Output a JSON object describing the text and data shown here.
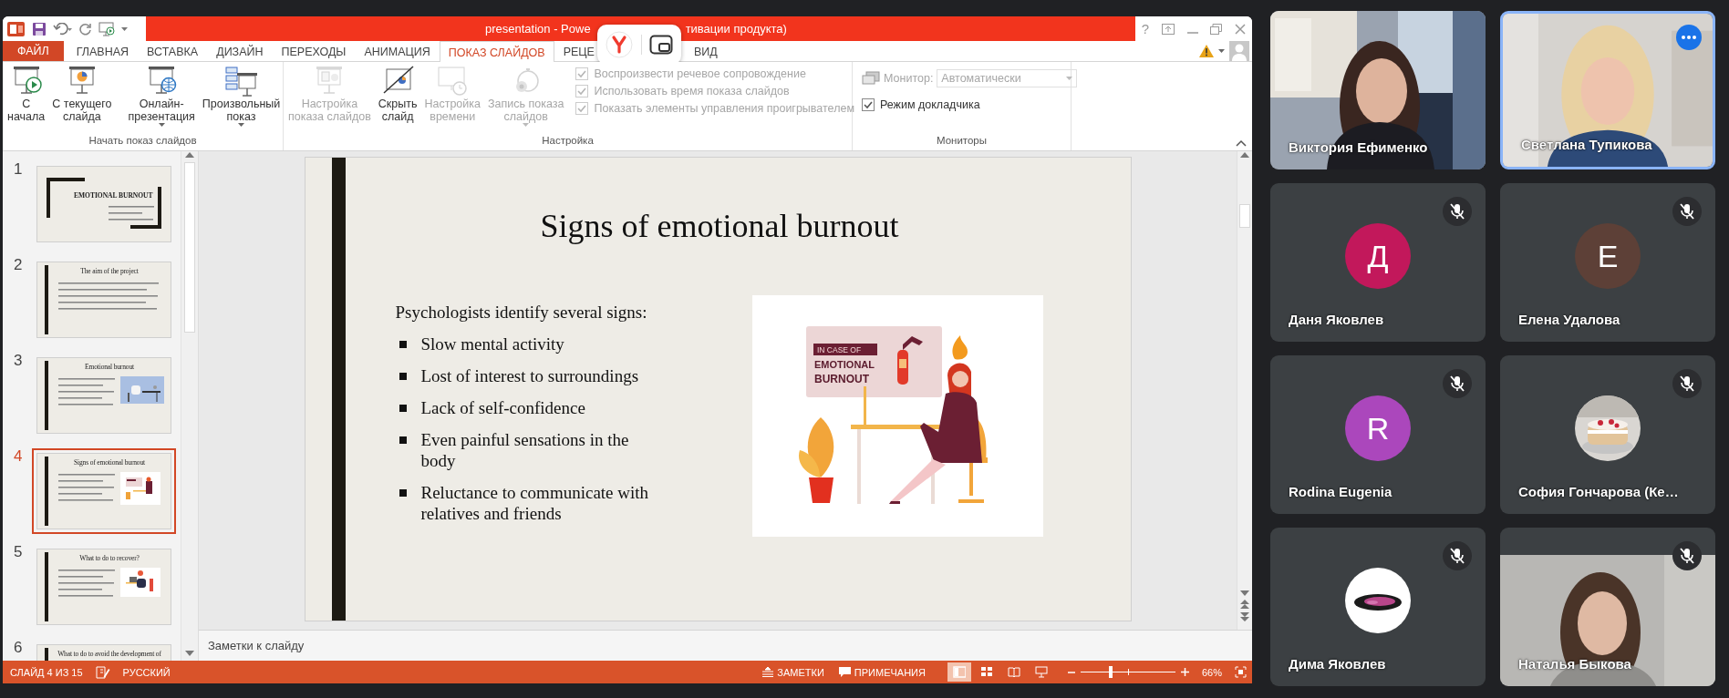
{
  "window": {
    "title_parts": [
      "presentation -  Powe",
      "тивации продукта)"
    ],
    "help": "?"
  },
  "tabs": [
    {
      "label": "ФАЙЛ",
      "kind": "file",
      "selected": false
    },
    {
      "label": "ГЛАВНАЯ",
      "kind": "tab",
      "selected": false
    },
    {
      "label": "ВСТАВКА",
      "kind": "tab",
      "selected": false
    },
    {
      "label": "ДИЗАЙН",
      "kind": "tab",
      "selected": false
    },
    {
      "label": "ПЕРЕХОДЫ",
      "kind": "tab",
      "selected": false
    },
    {
      "label": "АНИМАЦИЯ",
      "kind": "tab",
      "selected": false
    },
    {
      "label": "ПОКАЗ СЛАЙДОВ",
      "kind": "tab",
      "selected": true
    },
    {
      "label": "РЕЦЕ",
      "kind": "covered",
      "selected": false
    },
    {
      "label": "ВИД",
      "kind": "tab",
      "selected": false
    }
  ],
  "ribbon": {
    "groups": [
      {
        "label": "Начать показ слайдов",
        "buttons": [
          {
            "kind": "play",
            "lines": [
              "С",
              "начала"
            ],
            "dropdown": false,
            "disabled": false
          },
          {
            "kind": "current",
            "lines": [
              "С текущего",
              "слайда"
            ],
            "dropdown": false,
            "disabled": false
          },
          {
            "kind": "online",
            "lines": [
              "Онлайн-",
              "презентация"
            ],
            "dropdown": true,
            "disabled": false
          },
          {
            "kind": "custom",
            "lines": [
              "Произвольный",
              "показ"
            ],
            "dropdown": true,
            "disabled": false
          }
        ]
      },
      {
        "label": "Настройка",
        "buttons": [
          {
            "kind": "setup",
            "lines": [
              "Настройка",
              "показа слайдов"
            ],
            "dropdown": false,
            "disabled": true
          },
          {
            "kind": "hide",
            "lines": [
              "Скрыть",
              "слайд"
            ],
            "dropdown": false,
            "disabled": false
          },
          {
            "kind": "timing",
            "lines": [
              "Настройка",
              "времени"
            ],
            "dropdown": false,
            "disabled": true
          },
          {
            "kind": "record",
            "lines": [
              "Запись показа",
              "слайдов"
            ],
            "dropdown": true,
            "disabled": true
          }
        ],
        "checkboxes": [
          {
            "label": "Воспроизвести речевое сопровождение",
            "checked": true,
            "disabled": true
          },
          {
            "label": "Использовать время показа слайдов",
            "checked": true,
            "disabled": true
          },
          {
            "label": "Показать элементы управления проигрывателем",
            "checked": true,
            "disabled": true
          }
        ]
      },
      {
        "label": "Мониторы",
        "monitor": {
          "label": "Монитор:",
          "value": "Автоматически",
          "disabled": true
        },
        "checkboxes": [
          {
            "label": "Режим докладчика",
            "checked": true,
            "disabled": false
          }
        ]
      }
    ]
  },
  "thumbnails": [
    {
      "number": "1",
      "title": "EMOTIONAL BURNOUT",
      "kind": "title",
      "selected": false
    },
    {
      "number": "2",
      "title": "The aim of the project",
      "kind": "text",
      "selected": false
    },
    {
      "number": "3",
      "title": "Emotional burnout",
      "kind": "picture",
      "selected": false
    },
    {
      "number": "4",
      "title": "Signs of emotional burnout",
      "kind": "picture",
      "selected": true
    },
    {
      "number": "5",
      "title": "What to do to recover?",
      "kind": "picture",
      "selected": false
    },
    {
      "number": "6",
      "title": "What to do to avoid the development of",
      "kind": "text",
      "selected": false
    }
  ],
  "slide": {
    "title": "Signs of emotional burnout",
    "intro": "Psychologists identify several signs:",
    "bullets": [
      "Slow mental activity",
      "Lost of interest to surroundings",
      "Lack of self-confidence",
      "Even painful sensations in the body",
      "Reluctance to communicate with relatives and friends"
    ],
    "illustration": {
      "tag": "IN CASE OF",
      "headline": [
        "EMOTIONAL",
        "BURNOUT"
      ]
    }
  },
  "notes": {
    "placeholder": "Заметки к слайду"
  },
  "status_bar": {
    "slide": "СЛАЙД 4 ИЗ 15",
    "language": "РУССКИЙ",
    "notes": "ЗАМЕТКИ",
    "comments": "ПРИМЕЧАНИЯ",
    "views": [
      {
        "kind": "normal",
        "selected": true
      },
      {
        "kind": "sorter",
        "selected": false
      },
      {
        "kind": "reading",
        "selected": false
      },
      {
        "kind": "slideshow",
        "selected": false
      }
    ],
    "zoom": {
      "level": 0.32,
      "reading": "66%"
    }
  },
  "participants": [
    {
      "name": "Виктория Ефименко",
      "kind": "video",
      "muted": false,
      "highlighted": false
    },
    {
      "name": "Светлана Тупикова",
      "kind": "video",
      "muted": false,
      "highlighted": true
    },
    {
      "name": "Даня Яковлев",
      "kind": "letter",
      "letter": "Д",
      "color": "#c2185b",
      "muted": true,
      "highlighted": false
    },
    {
      "name": "Елена Удалова",
      "kind": "letter",
      "letter": "Е",
      "color": "#5d4037",
      "muted": true,
      "highlighted": false
    },
    {
      "name": "Rodina Eugenia",
      "kind": "letter",
      "letter": "R",
      "color": "#ab47bc",
      "muted": true,
      "highlighted": false
    },
    {
      "name": "София Гончарова (Ке…",
      "muted": true,
      "highlighted": false
    },
    {
      "name": "Дима Яковлев",
      "muted": true,
      "highlighted": false
    },
    {
      "name": "Наталья Быкова",
      "kind": "video",
      "muted": true,
      "highlighted": false
    }
  ]
}
